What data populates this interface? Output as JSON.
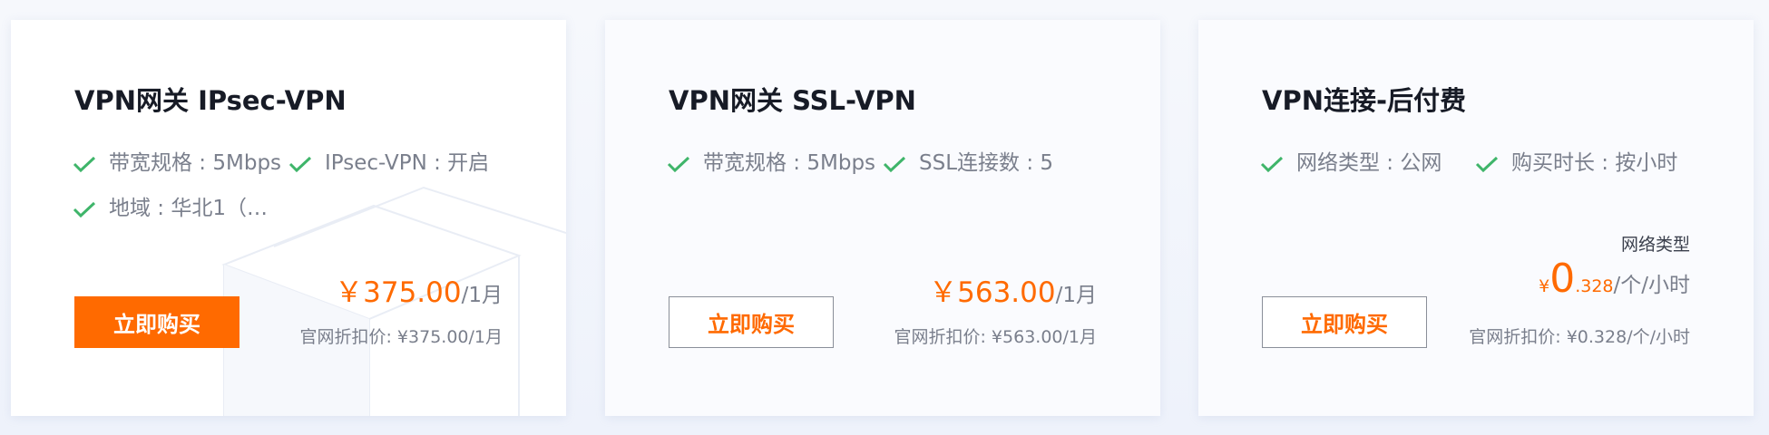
{
  "colors": {
    "accent": "#ff6a00",
    "check": "#3fb56a",
    "title": "#171b26",
    "muted": "#7a7f8c"
  },
  "cards": [
    {
      "title": "VPN网关 IPsec-VPN",
      "features": [
        "带宽规格 : 5Mbps",
        "IPsec-VPN : 开启",
        "地域 : 华北1（…"
      ],
      "price": {
        "currency": "￥",
        "amount": "375.00",
        "unit": "/1月"
      },
      "discount": "官网折扣价: ¥375.00/1月",
      "button": "立即购买"
    },
    {
      "title": "VPN网关 SSL-VPN",
      "features": [
        "带宽规格 : 5Mbps",
        "SSL连接数 : 5"
      ],
      "price": {
        "currency": "￥",
        "amount": "563.00",
        "unit": "/1月"
      },
      "discount": "官网折扣价: ¥563.00/1月",
      "button": "立即购买"
    },
    {
      "title": "VPN连接-后付费",
      "features": [
        "网络类型 : 公网",
        "购买时长 : 按小时"
      ],
      "price_label": "网络类型",
      "price": {
        "currency": "¥",
        "int": "0",
        "decimal": ".328",
        "unit": "/个/小时"
      },
      "discount": "官网折扣价: ¥0.328/个/小时",
      "button": "立即购买"
    }
  ]
}
